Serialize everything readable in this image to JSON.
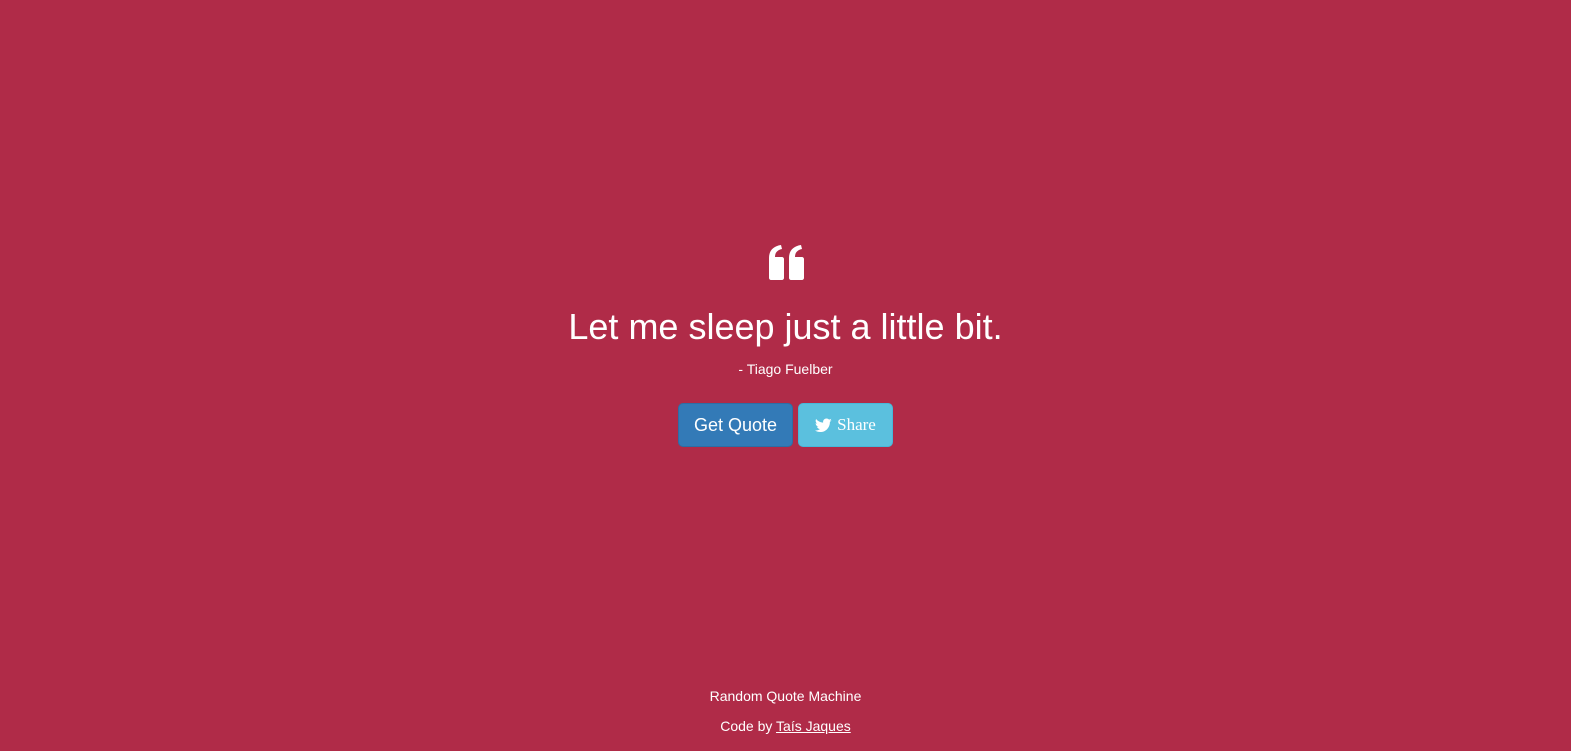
{
  "page": {
    "background_color": "#b02b48"
  },
  "quote": {
    "icon": "quote-left-icon",
    "text": "Let me sleep just a little bit.",
    "author": "- Tiago Fuelber"
  },
  "buttons": {
    "get_quote_label": "Get Quote",
    "get_quote_color": "#337ab7",
    "share_label": "Share",
    "share_icon": "twitter-icon",
    "share_color": "#5bc0de"
  },
  "footer": {
    "title": "Random Quote Machine",
    "credit_prefix": "Code by",
    "author_link": "Taís Jaques"
  }
}
